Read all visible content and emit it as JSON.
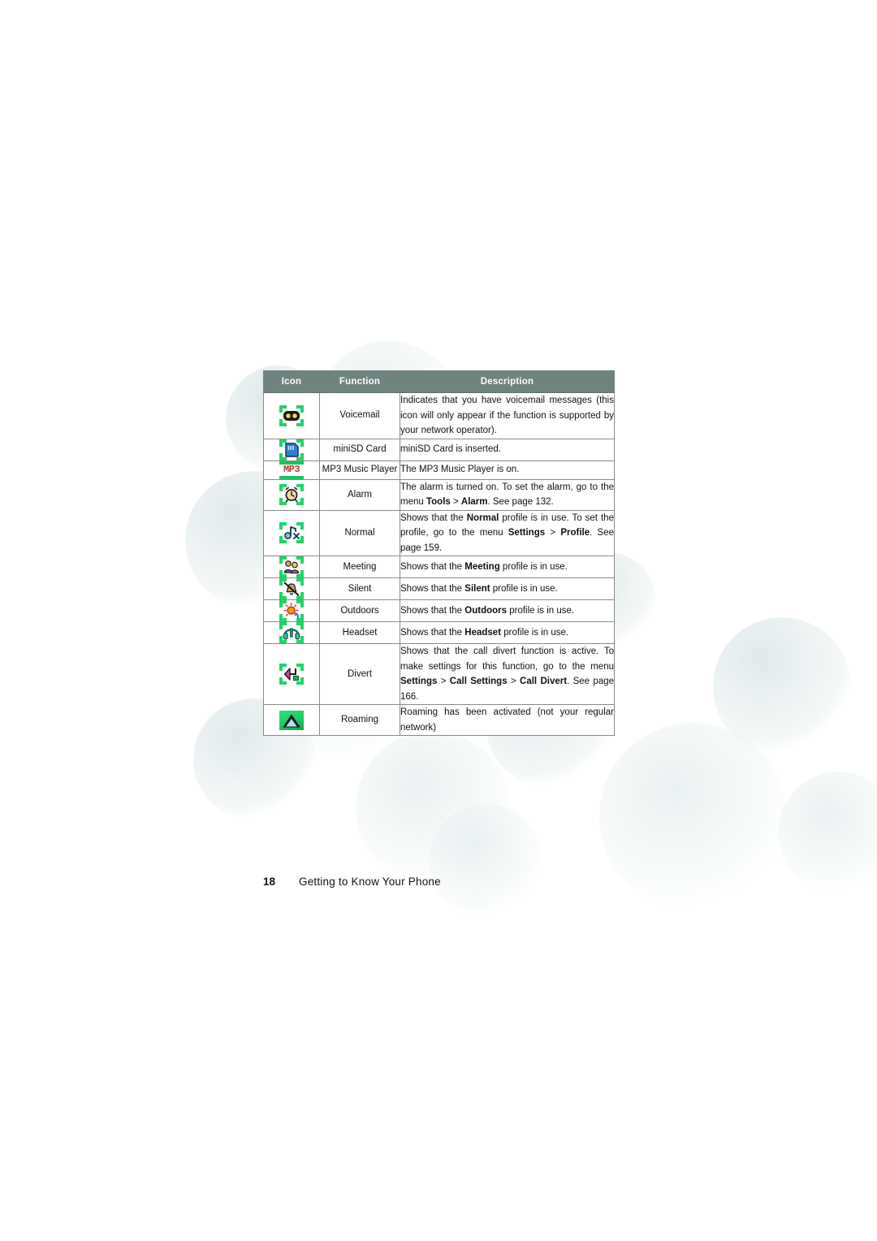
{
  "page": {
    "number": "18",
    "chapter": "Getting to Know Your Phone"
  },
  "table": {
    "headers": {
      "icon": "Icon",
      "function": "Function",
      "description": "Description"
    },
    "header_bg": "#6f837f",
    "header_text_color": "#ffffff",
    "border_color": "#8a8a8a",
    "rows": [
      {
        "icon_name": "voicemail-icon",
        "function": "Voicemail",
        "description": "Indicates that you have voicemail messages (this icon will only appear if the function is supported by your network operator)."
      },
      {
        "icon_name": "minisd-card-icon",
        "function": "miniSD Card",
        "description": "miniSD Card is inserted."
      },
      {
        "icon_name": "mp3-music-player-icon",
        "function": "MP3 Music Player",
        "description": "The MP3 Music Player is on."
      },
      {
        "icon_name": "alarm-clock-icon",
        "function": "Alarm",
        "description": "The alarm is turned on. To set the alarm, go to the menu Tools > Alarm. See page 132."
      },
      {
        "icon_name": "normal-profile-icon",
        "function": "Normal",
        "description": "Shows that the Normal profile is in use. To set the profile, go to the menu Settings > Profile. See page 159."
      },
      {
        "icon_name": "meeting-profile-icon",
        "function": "Meeting",
        "description": "Shows that the Meeting profile is in use."
      },
      {
        "icon_name": "silent-profile-icon",
        "function": "Silent",
        "description": "Shows that the Silent profile is in use."
      },
      {
        "icon_name": "outdoors-profile-icon",
        "function": "Outdoors",
        "description": "Shows that the Outdoors profile is in use."
      },
      {
        "icon_name": "headset-profile-icon",
        "function": "Headset",
        "description": "Shows that the Headset profile is in use."
      },
      {
        "icon_name": "call-divert-icon",
        "function": "Divert",
        "description": "Shows that the call divert function is active. To make settings for this function, go to the menu Settings > Call Settings > Call Divert. See page 166."
      },
      {
        "icon_name": "roaming-icon",
        "function": "Roaming",
        "description": "Roaming has been activated (not your regular network)"
      }
    ]
  }
}
